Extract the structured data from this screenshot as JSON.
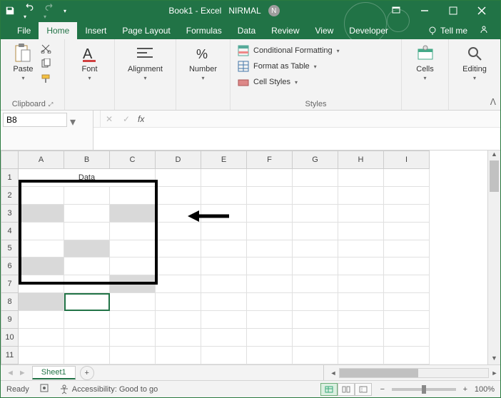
{
  "titlebar": {
    "doc_title": "Book1 - Excel",
    "user_name": "NIRMAL",
    "user_initial": "N"
  },
  "tabs": {
    "file": "File",
    "home": "Home",
    "insert": "Insert",
    "page_layout": "Page Layout",
    "formulas": "Formulas",
    "data": "Data",
    "review": "Review",
    "view": "View",
    "developer": "Developer",
    "tellme": "Tell me"
  },
  "ribbon": {
    "clipboard": {
      "title": "Clipboard",
      "paste": "Paste"
    },
    "font": {
      "title": "Font"
    },
    "alignment": {
      "title": "Alignment"
    },
    "number": {
      "title": "Number"
    },
    "styles": {
      "title": "Styles",
      "cond": "Conditional Formatting",
      "fmt_table": "Format as Table",
      "cell_styles": "Cell Styles"
    },
    "cells": {
      "title": "Cells"
    },
    "editing": {
      "title": "Editing"
    }
  },
  "name_box": {
    "value": "B8"
  },
  "formula_bar": {
    "fx_label": "fx",
    "value": ""
  },
  "columns": [
    "A",
    "B",
    "C",
    "D",
    "E",
    "F",
    "G",
    "H",
    "I"
  ],
  "rows": [
    "1",
    "2",
    "3",
    "4",
    "5",
    "6",
    "7",
    "8",
    "9",
    "10",
    "11"
  ],
  "sheet": {
    "header_cell": {
      "row": 1,
      "span_cols": [
        "A",
        "B",
        "C"
      ],
      "value": "Data"
    },
    "shaded_cells": [
      "A3",
      "C3",
      "B5",
      "A6",
      "C7",
      "A8"
    ],
    "selected_cell": "B8",
    "border_range": "A2:C8"
  },
  "sheet_tabs": {
    "active": "Sheet1"
  },
  "status": {
    "ready": "Ready",
    "accessibility": "Accessibility: Good to go",
    "zoom": "100%"
  }
}
